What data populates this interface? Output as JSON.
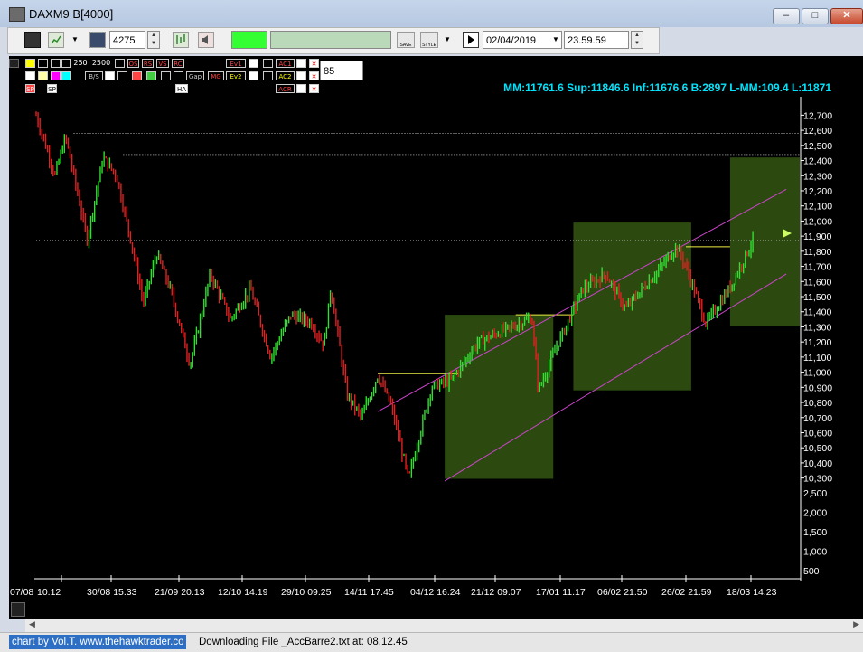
{
  "window": {
    "title": "DAXM9 B[4000]",
    "buttons": [
      "–",
      "□",
      "✕"
    ]
  },
  "toolbar": {
    "bars_value": "4275",
    "date_value": "02/04/2019",
    "time_value": "23.59.59",
    "save_label": "SAVE",
    "style_label": "STYLE",
    "green_color": "#33ff33",
    "pale_color": "#b9d9b9"
  },
  "indicators": {
    "row1_values": [
      "250",
      "2500"
    ],
    "row1_labels": [
      "OS",
      "RS",
      "VS",
      "RC",
      "Ev1",
      "AC1"
    ],
    "row2_labels": [
      "B/S",
      "Gap",
      "MG",
      "Ev2",
      "AC2"
    ],
    "row3_labels": [
      "SP",
      "SP",
      "HA",
      "ACR"
    ],
    "period_value": "85"
  },
  "chart": {
    "header_text": "MM:11761.6 Sup:11846.6 Inf:11676.6 B:2897 L-MM:109.4 L:11871",
    "price_ticks": [
      "12,700",
      "12,600",
      "12,500",
      "12,400",
      "12,300",
      "12,200",
      "12,100",
      "12,000",
      "11,900",
      "11,800",
      "11,700",
      "11,600",
      "11,500",
      "11,400",
      "11,300",
      "11,200",
      "11,100",
      "11,000",
      "10,900",
      "10,800",
      "10,700",
      "10,600",
      "10,500",
      "10,400",
      "10,300"
    ],
    "volume_ticks": [
      "2,500",
      "2,000",
      "1,500",
      "1,000",
      "500"
    ],
    "date_ticks": [
      "07/08",
      "10.12",
      "30/08 15.33",
      "21/09 20.13",
      "12/10 14.19",
      "29/10 09.25",
      "14/11 17.45",
      "04/12 16.24",
      "21/12 09.07",
      "17/01 11.17",
      "06/02 21.50",
      "26/02 21.59",
      "18/03 14.23"
    ],
    "colors": {
      "up": "#33dd33",
      "down": "#dd2222",
      "box": "#2c4a10",
      "channel": "#cc44cc",
      "header": "#00e5ff"
    }
  },
  "chart_data": {
    "type": "candlestick",
    "x_labels": [
      "07/08",
      "10.12",
      "30/08 15.33",
      "21/09 20.13",
      "12/10 14.19",
      "29/10 09.25",
      "14/11 17.45",
      "04/12 16.24",
      "21/12 09.07",
      "17/01 11.17",
      "06/02 21.50",
      "26/02 21.59",
      "18/03 14.23"
    ],
    "ylim": [
      10250,
      12780
    ],
    "price_path": [
      [
        0,
        12700
      ],
      [
        1.4,
        12300
      ],
      [
        2.2,
        12560
      ],
      [
        3.8,
        11880
      ],
      [
        5,
        12420
      ],
      [
        6,
        12300
      ],
      [
        7,
        11900
      ],
      [
        8,
        11460
      ],
      [
        9,
        11780
      ],
      [
        10,
        11550
      ],
      [
        11.5,
        11050
      ],
      [
        13,
        11650
      ],
      [
        14.5,
        11350
      ],
      [
        16,
        11550
      ],
      [
        17.5,
        11100
      ],
      [
        19,
        11380
      ],
      [
        20.5,
        11330
      ],
      [
        21.5,
        11180
      ],
      [
        22,
        11560
      ],
      [
        22.6,
        11200
      ],
      [
        23.2,
        10850
      ],
      [
        24.3,
        10700
      ],
      [
        25.5,
        10980
      ],
      [
        26.5,
        10780
      ],
      [
        27.8,
        10290
      ],
      [
        29.5,
        10900
      ],
      [
        31,
        10950
      ],
      [
        33,
        11200
      ],
      [
        35.5,
        11300
      ],
      [
        37,
        11360
      ],
      [
        37.5,
        10880
      ],
      [
        39,
        11200
      ],
      [
        40.8,
        11550
      ],
      [
        42.5,
        11650
      ],
      [
        44,
        11420
      ],
      [
        46.5,
        11680
      ],
      [
        47.8,
        11830
      ],
      [
        48.5,
        11700
      ],
      [
        50,
        11320
      ],
      [
        51.8,
        11560
      ],
      [
        53.5,
        11871
      ]
    ],
    "horizontal_levels": [
      12580,
      12440,
      11871
    ],
    "channel_lines": [
      {
        "from": [
          25.5,
          10740
        ],
        "to": [
          56,
          12210
        ]
      },
      {
        "from": [
          30.5,
          10280
        ],
        "to": [
          56,
          11650
        ]
      }
    ],
    "boxes": [
      {
        "x": [
          30.5,
          38.6
        ],
        "y": [
          10295,
          11380
        ]
      },
      {
        "x": [
          40.1,
          48.9
        ],
        "y": [
          10880,
          11990
        ]
      },
      {
        "x": [
          51.8,
          57
        ],
        "y": [
          11305,
          12420
        ]
      }
    ],
    "volume_ylim": [
      300,
      2600
    ]
  }
}
